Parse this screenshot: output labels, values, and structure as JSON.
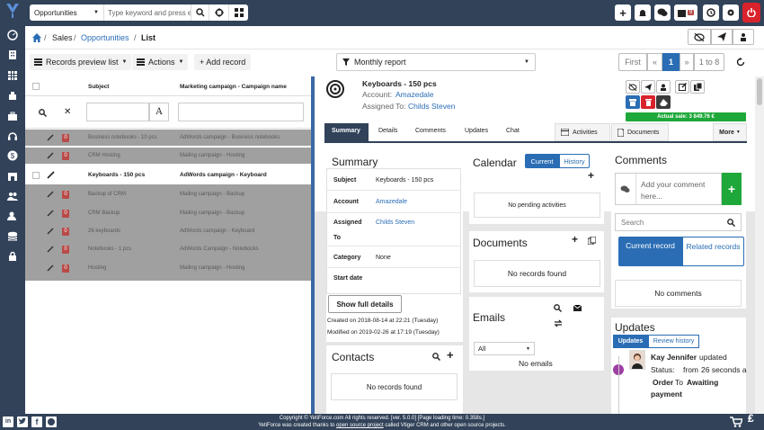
{
  "topbar": {
    "module_select": "Opportunities",
    "search_placeholder": "Type keyword and press e",
    "notif_count": "9"
  },
  "breadcrumb": {
    "sales": "Sales",
    "opportunities": "Opportunities",
    "list": "List"
  },
  "toolbar": {
    "records_preview": "Records preview list",
    "actions": "Actions",
    "add_record": "+ Add record",
    "report": "Monthly report",
    "first": "First",
    "prev": "«",
    "page": "1",
    "next": "»",
    "range": "1 to 8"
  },
  "list": {
    "col_subject": "Subject",
    "col_campaign": "Marketing campaign - Campaign name",
    "selected_subject": "Keyboards - 150 pcs",
    "selected_campaign": "AdWords campaign - Keyboard",
    "rows": [
      {
        "badge": "0",
        "subject": "Business notebooks - 10 pcs",
        "campaign": "AdWords campaign - Business notebooks"
      },
      {
        "badge": "0",
        "subject": "CRM Hosting",
        "campaign": "Mailing campaign - Hosting"
      },
      {
        "badge": "0",
        "subject": "Backup of CRM",
        "campaign": "Mailing campaign - Backup"
      },
      {
        "badge": "0",
        "subject": "CRM Backup",
        "campaign": "Mailing campaign - Backup"
      },
      {
        "badge": "0",
        "subject": "26 keyboards",
        "campaign": "AdWords campaign - Keyboard"
      },
      {
        "badge": "0",
        "subject": "Notebooks - 1 pcs",
        "campaign": "AdWords Campaign - Notebooks"
      },
      {
        "badge": "0",
        "subject": "Hosting",
        "campaign": "Mailing campaign - Hosting"
      }
    ]
  },
  "record": {
    "title": "Keyboards - 150 pcs",
    "account_label": "Account:",
    "account": "Amazedale",
    "assigned_label": "Assigned To:",
    "assigned": "Childs Steven",
    "actual_sale": "Actual sale: 3 849.76 €"
  },
  "tabs": {
    "summary": "Summary",
    "details": "Details",
    "comments": "Comments",
    "updates": "Updates",
    "chat": "Chat",
    "activities": "Activities",
    "documents": "Documents",
    "more": "More"
  },
  "summary": {
    "title": "Summary",
    "subject_l": "Subject",
    "subject_v": "Keyboards - 150 pcs",
    "account_l": "Account",
    "account_v": "Amazedale",
    "assigned_l": "Assigned",
    "assigned_l2": "To",
    "assigned_v": "Childs Steven",
    "category_l": "Category",
    "category_v": "None",
    "start_l": "Start date",
    "show_full": "Show full details",
    "created": "Created on 2018-08-14 at 22:21 (Tuesday)",
    "modified": "Modified on 2019-02-26 at 17:19 (Tuesday)"
  },
  "contacts": {
    "title": "Contacts",
    "empty": "No records found"
  },
  "calendar": {
    "title": "Calendar",
    "current": "Current",
    "history": "History",
    "empty": "No pending activities"
  },
  "documents": {
    "title": "Documents",
    "empty": "No records found"
  },
  "emails": {
    "title": "Emails",
    "filter": "All",
    "empty": "No emails"
  },
  "comments": {
    "title": "Comments",
    "placeholder": "Add your comment here...",
    "search": "Search",
    "current": "Current record",
    "related": "Related records",
    "empty": "No comments"
  },
  "updates": {
    "title": "Updates",
    "tab_updates": "Updates",
    "tab_review": "Review history",
    "user": "Kay Jennifer",
    "action": "updated",
    "status_l": "Status:",
    "from": "from",
    "from_v": "26 seconds a",
    "order": "Order",
    "to": "To",
    "to_v": "Awaiting",
    "payment": "payment"
  },
  "footer": {
    "line1": "Copyright © YetiForce.com All rights reserved. [ver. 5.0.0] [Page loading time: 0.358s.]",
    "line2a": "YetiForce was created thanks to ",
    "line2link": "open source project",
    "line2b": " called Vtiger CRM and other open source projects."
  }
}
